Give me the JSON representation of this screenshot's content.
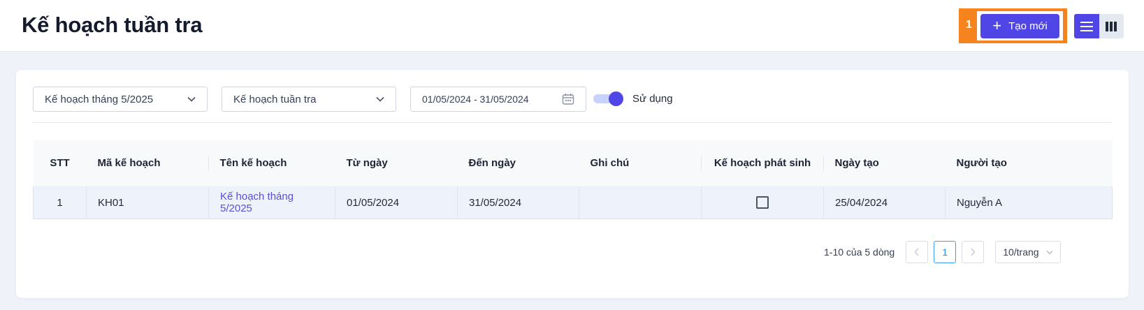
{
  "header": {
    "title": "Kế hoạch tuần tra",
    "annotation_number": "1",
    "create_button": {
      "label": "Tạo mới",
      "icon": "plus-icon"
    },
    "view_toggle": [
      {
        "icon": "list-view-icon",
        "active": true
      },
      {
        "icon": "column-view-icon",
        "active": false
      }
    ]
  },
  "filters": {
    "plan_select": {
      "value": "Kế hoạch tháng 5/2025",
      "icon": "chevron-down-icon"
    },
    "type_select": {
      "value": "Kế hoạch tuần tra",
      "icon": "chevron-down-icon"
    },
    "date_range": {
      "value": "01/05/2024 - 31/05/2024",
      "icon": "calendar-icon"
    },
    "active_toggle": {
      "label": "Sử dụng",
      "on": true
    }
  },
  "table": {
    "columns": [
      "STT",
      "Mã kế hoạch",
      "Tên kế hoạch",
      "Từ ngày",
      "Đến ngày",
      "Ghi chú",
      "Kế hoạch phát sinh",
      "Ngày tạo",
      "Người tạo"
    ],
    "rows": [
      {
        "stt": "1",
        "code": "KH01",
        "name": "Kế hoạch tháng 5/2025",
        "from": "01/05/2024",
        "to": "31/05/2024",
        "note": "",
        "incurred": false,
        "created": "25/04/2024",
        "creator": "Nguyễn A"
      }
    ]
  },
  "pagination": {
    "info": "1-10 của 5 dòng",
    "current_page": "1",
    "page_size": "10/trang",
    "prev_icon": "chevron-left-icon",
    "next_icon": "chevron-right-icon"
  },
  "colors": {
    "primary": "#5046e5",
    "highlight": "#f5841f",
    "link": "#5a4fdc",
    "page_bg": "#eff3f9"
  }
}
